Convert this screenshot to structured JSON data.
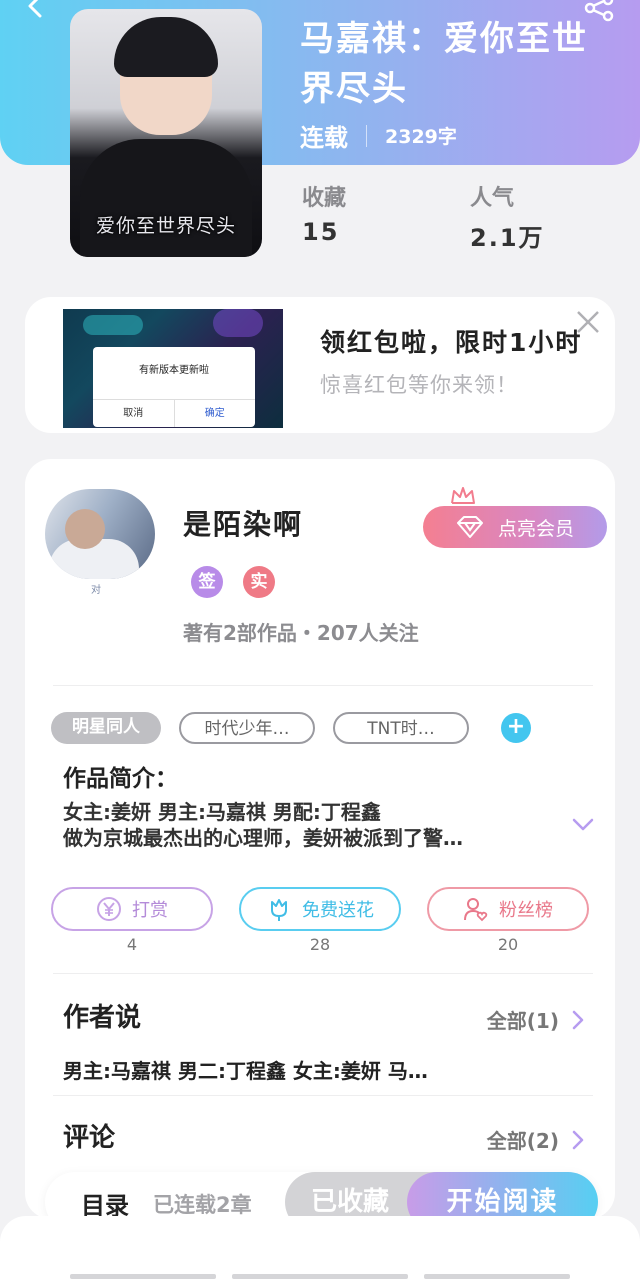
{
  "book": {
    "title": "马嘉祺：爱你至世界尽头",
    "cover_caption": "爱你至世界尽头",
    "status": "连载",
    "word_count": "2329字",
    "stats": {
      "favorites_label": "收藏",
      "favorites_value": "15",
      "popularity_label": "人气",
      "popularity_value": "2.1万"
    }
  },
  "promo": {
    "dialog_message": "有新版本更新啦",
    "dialog_cancel": "取消",
    "dialog_ok": "确定",
    "title": "领红包啦，限时1小时",
    "subtitle": "惊喜红包等你来领！"
  },
  "author": {
    "avatar_caption": "对",
    "name": "是陌染啊",
    "badge_sign": "签",
    "badge_real": "实",
    "meta": "著有2部作品・207人关注",
    "vip_label": "点亮会员"
  },
  "tags": [
    {
      "label": "明星同人"
    },
    {
      "label": "时代少年…"
    },
    {
      "label": "TNT时…"
    }
  ],
  "intro": {
    "title": "作品简介：",
    "line1": "女主:姜妍 男主:马嘉祺 男配:丁程鑫",
    "line2": "做为京城最杰出的心理师，姜妍被派到了警…"
  },
  "actions": {
    "reward_label": "打赏",
    "reward_count": "4",
    "flower_label": "免费送花",
    "flower_count": "28",
    "fans_label": "粉丝榜",
    "fans_count": "20"
  },
  "author_says": {
    "title": "作者说",
    "link": "全部(1)",
    "content": "男主:马嘉祺 男二:丁程鑫 女主:姜妍 马…"
  },
  "comments": {
    "title": "评论",
    "link": "全部(2)"
  },
  "bottom_bar": {
    "toc": "目录",
    "chapters": "已连载2章",
    "collected": "已收藏",
    "read": "开始阅读"
  },
  "colors": {
    "header_gradient_start": "#5fd1f3",
    "header_gradient_end": "#b69cf0",
    "accent_blue": "#43c6ef",
    "accent_pink": "#f47f91"
  }
}
